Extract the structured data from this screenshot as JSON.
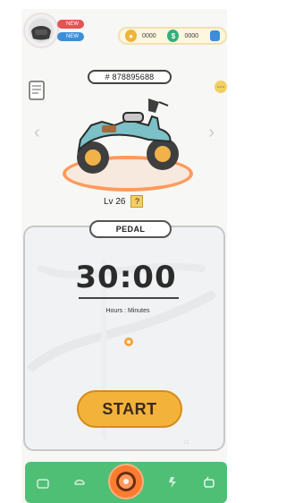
{
  "header": {
    "badge_red": "NEW",
    "badge_blue": "NEW",
    "currency": {
      "gold_value": "0000",
      "green_value": "0000",
      "gold_icon": "coin-icon",
      "green_icon": "coin-icon",
      "wallet_icon": "wallet-icon"
    }
  },
  "vehicle": {
    "code": "# 878895688",
    "level": "Lv 26",
    "help": "?"
  },
  "session": {
    "mode": "PEDAL",
    "time": "30:00",
    "time_label": "Hours : Minutes",
    "start_label": "START"
  },
  "nav": {
    "items": [
      "home-icon",
      "helmet-icon",
      "wheel-icon",
      "bolt-icon",
      "cart-icon"
    ]
  },
  "colors": {
    "accent": "#4fbf76",
    "orange": "#f3b23a",
    "ring": "#ff9a5c"
  }
}
